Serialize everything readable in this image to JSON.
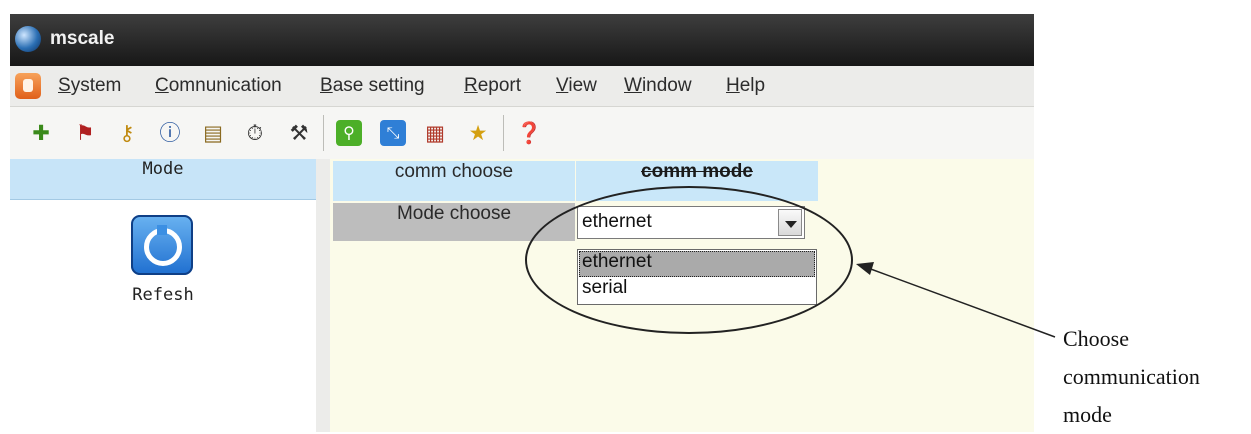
{
  "window": {
    "title": "mscale"
  },
  "menu": {
    "items": [
      "System",
      "Comnunication",
      "Base setting",
      "Report",
      "View",
      "Window",
      "Help"
    ]
  },
  "toolbar": {
    "icons": [
      "add-icon",
      "flag-icon",
      "key-icon",
      "info-icon",
      "document-icon",
      "stopwatch-icon",
      "tools-icon",
      "search-icon",
      "chart-icon",
      "calendar-icon",
      "star-icon",
      "help-icon"
    ]
  },
  "left_panel": {
    "header": "Mode",
    "refresh_label": "Refesh"
  },
  "right_panel": {
    "row1": {
      "label": "comm choose",
      "value": "comm mode"
    },
    "row2": {
      "label": "Mode choose",
      "selected": "ethernet"
    },
    "options": [
      "ethernet",
      "serial"
    ]
  },
  "annotation": {
    "lines": [
      "Choose",
      "communication",
      "mode"
    ]
  }
}
